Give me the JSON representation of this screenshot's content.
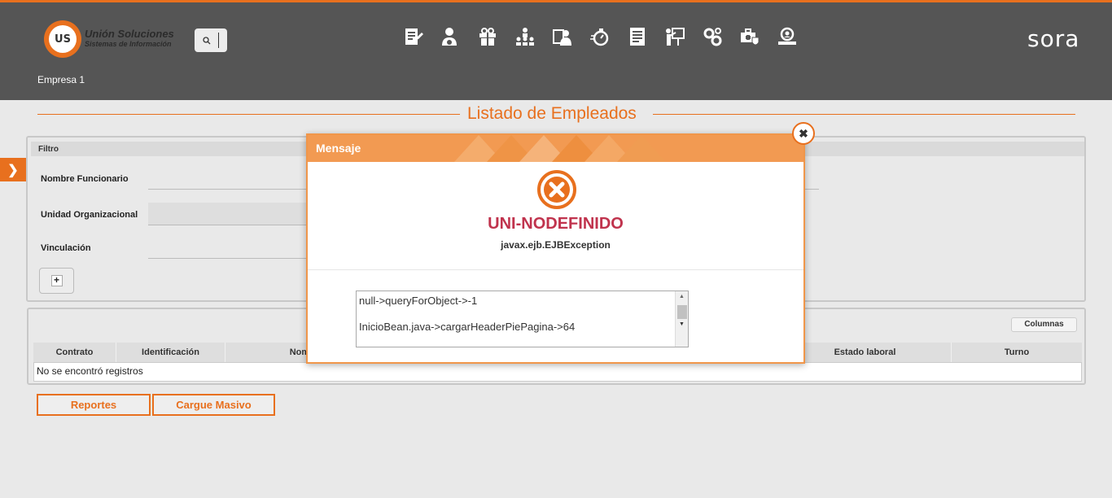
{
  "header": {
    "logo_line1": "Unión Soluciones",
    "logo_line2": "Sistemas de Información",
    "logo_badge": "US",
    "company": "Empresa 1",
    "brand": "sora",
    "nav_icons": [
      "edit-document-icon",
      "user-admin-icon",
      "gift-icon",
      "org-chart-icon",
      "id-card-user-icon",
      "stopwatch-icon",
      "document-list-icon",
      "presentation-icon",
      "gears-icon",
      "medical-case-icon",
      "search-user-icon"
    ]
  },
  "page": {
    "title": "Listado de Empleados"
  },
  "filter": {
    "heading": "Filtro",
    "fields": [
      "Nombre Funcionario",
      "Unidad Organizacional",
      "Vinculación"
    ]
  },
  "table": {
    "columns_button": "Columnas",
    "headers": [
      "Contrato",
      "Identificación",
      "Nombre",
      "Estado laboral",
      "Turno"
    ],
    "empty_message": "No se encontró registros"
  },
  "actions": {
    "reports": "Reportes",
    "bulk_load": "Cargue Masivo"
  },
  "dialog": {
    "title": "Mensaje",
    "error_code": "UNI-NODEFINIDO",
    "error_message": "javax.ejb.EJBException",
    "detail_line1": "null->queryForObject->-1",
    "detail_line2": "InicioBean.java->cargarHeaderPiePagina->64"
  },
  "colors": {
    "accent": "#e8701e",
    "header_bg": "#555555",
    "error_red": "#c0334d",
    "dialog_head": "#f29a52"
  }
}
